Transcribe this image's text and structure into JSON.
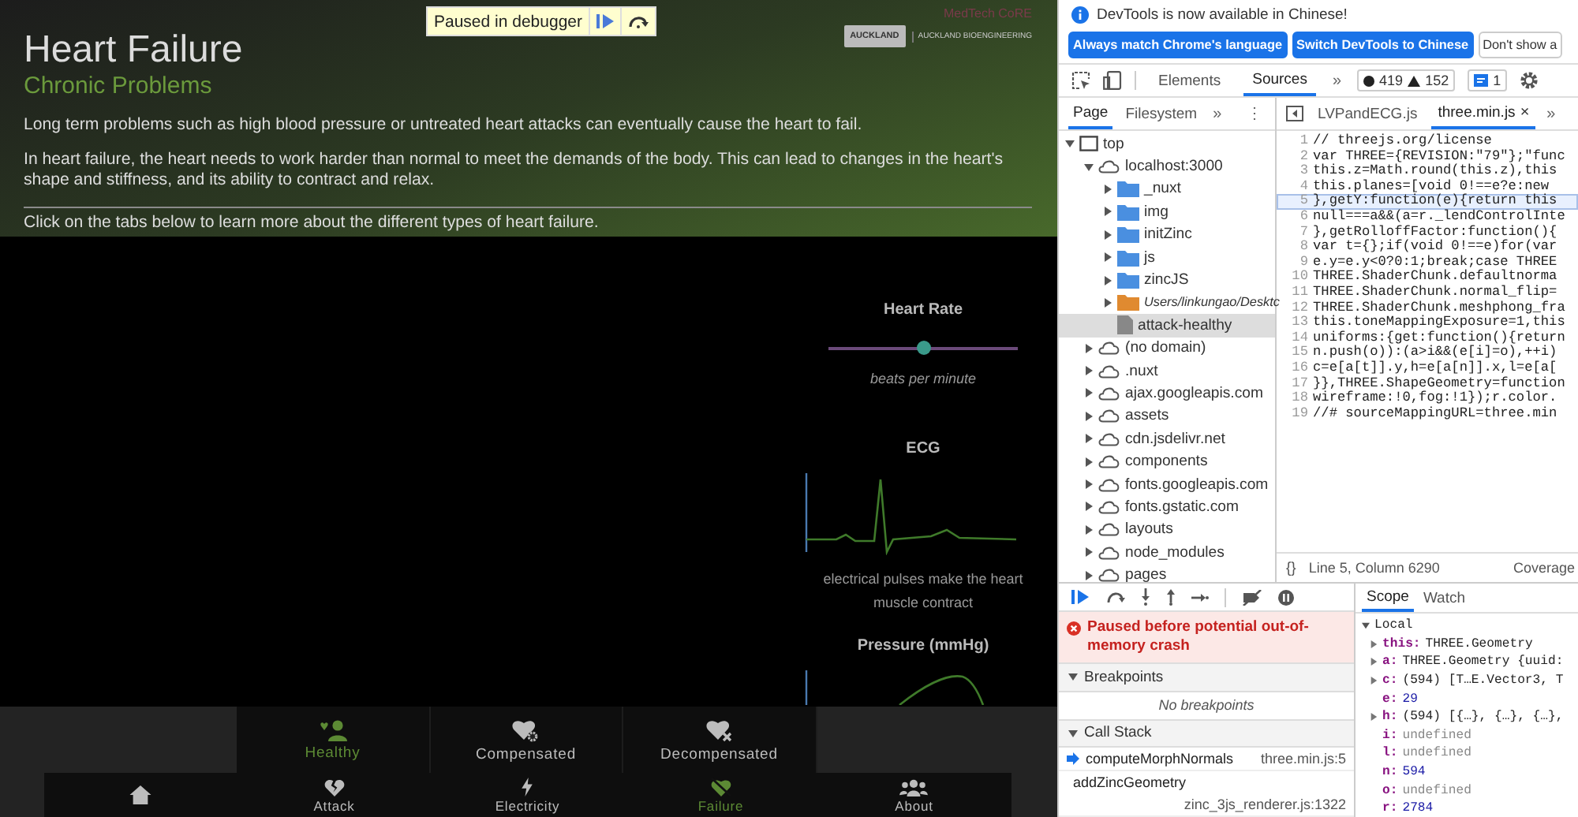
{
  "page": {
    "title": "Heart Failure",
    "subtitle": "Chronic Problems",
    "paragraphs": [
      "Long term problems such as high blood pressure or untreated heart attacks can eventually cause the heart to fail.",
      "In heart failure, the heart needs to work harder than normal to meet the demands of the body. This can lead to changes in the heart's shape and stiffness, and its ability to contract and relax."
    ],
    "instruction": "Click on the tabs below to learn more about the different types of heart failure."
  },
  "logos": {
    "core": "MedTech CoRE",
    "university": "AUCKLAND",
    "institute": "AUCKLAND BIOENGINEERING"
  },
  "debugger_overlay": {
    "label": "Paused in debugger"
  },
  "sidebar": {
    "heart_rate": {
      "title": "Heart Rate",
      "level": 0.5,
      "unit": "beats per minute"
    },
    "ecg": {
      "title": "ECG",
      "caption": "electrical pulses make the heart muscle contract"
    },
    "pressure": {
      "title": "Pressure (mmHg)"
    }
  },
  "tabs_top": [
    {
      "label": "Healthy",
      "kind": "healthy",
      "selected": true
    },
    {
      "label": "Compensated",
      "kind": "compensated",
      "selected": false
    },
    {
      "label": "Decompensated",
      "kind": "decompensated",
      "selected": false
    }
  ],
  "tabs_bottom": [
    {
      "kind": "home",
      "selected": false
    },
    {
      "label": "Attack",
      "kind": "attack",
      "selected": false
    },
    {
      "label": "Electricity",
      "kind": "electricity",
      "selected": false
    },
    {
      "label": "Failure",
      "kind": "failure",
      "selected": true
    },
    {
      "label": "About",
      "kind": "about",
      "selected": false
    }
  ],
  "devtools": {
    "infobar": "DevTools is now available in Chinese!",
    "infobar_buttons": [
      {
        "label": "Always match Chrome's language",
        "primary": true
      },
      {
        "label": "Switch DevTools to Chinese",
        "primary": true
      },
      {
        "label": "Don't show a",
        "primary": false
      }
    ],
    "panels": [
      {
        "label": "Elements",
        "selected": false
      },
      {
        "label": "Sources",
        "selected": true
      }
    ],
    "more": "»",
    "errors": "419",
    "warnings": "152",
    "messages": "1",
    "navigator_tabs": [
      {
        "label": "Page",
        "selected": true
      },
      {
        "label": "Filesystem",
        "selected": false
      }
    ],
    "navigator_more": "»",
    "navigator_menu": "⋮",
    "tree": [
      {
        "label": "top",
        "kind": "frame",
        "expanded": true,
        "selected": false,
        "children": [
          {
            "label": "localhost:3000",
            "kind": "domain",
            "expanded": true,
            "selected": false,
            "children": [
              {
                "label": "_nuxt",
                "kind": "folder",
                "expanded": false,
                "selected": false
              },
              {
                "label": "img",
                "kind": "folder",
                "expanded": false,
                "selected": false
              },
              {
                "label": "initZinc",
                "kind": "folder",
                "expanded": false,
                "selected": false
              },
              {
                "label": "js",
                "kind": "folder",
                "expanded": false,
                "selected": false
              },
              {
                "label": "zincJS",
                "kind": "folder",
                "expanded": false,
                "selected": false
              },
              {
                "label": "Users/linkungao/Desktc",
                "kind": "local_folder",
                "expanded": false,
                "selected": false
              },
              {
                "label": "attack-healthy",
                "kind": "file",
                "selected": true
              }
            ]
          },
          {
            "label": "(no domain)",
            "kind": "domain",
            "expanded": false,
            "selected": false
          },
          {
            "label": ".nuxt",
            "kind": "domain",
            "expanded": false,
            "selected": false
          },
          {
            "label": "ajax.googleapis.com",
            "kind": "domain",
            "expanded": false,
            "selected": false
          },
          {
            "label": "assets",
            "kind": "domain",
            "expanded": false,
            "selected": false
          },
          {
            "label": "cdn.jsdelivr.net",
            "kind": "domain",
            "expanded": false,
            "selected": false
          },
          {
            "label": "components",
            "kind": "domain",
            "expanded": false,
            "selected": false
          },
          {
            "label": "fonts.googleapis.com",
            "kind": "domain",
            "expanded": false,
            "selected": false
          },
          {
            "label": "fonts.gstatic.com",
            "kind": "domain",
            "expanded": false,
            "selected": false
          },
          {
            "label": "layouts",
            "kind": "domain",
            "expanded": false,
            "selected": false
          },
          {
            "label": "node_modules",
            "kind": "domain",
            "expanded": false,
            "selected": false
          },
          {
            "label": "pages",
            "kind": "domain",
            "expanded": false,
            "selected": false
          }
        ]
      }
    ],
    "editor_tabs": [
      {
        "label": "LVPandECG.js",
        "selected": false
      },
      {
        "label": "three.min.js",
        "selected": true,
        "close": "×"
      }
    ],
    "editor_more": "»",
    "code": [
      {
        "number": "1",
        "text": "// threejs.org/license",
        "highlighted": false
      },
      {
        "number": "2",
        "text": "var THREE={REVISION:\"79\"};\"func",
        "highlighted": false
      },
      {
        "number": "3",
        "text": "this.z=Math.round(this.z),this",
        "highlighted": false
      },
      {
        "number": "4",
        "text": "this.planes=[void 0!==e?e:new",
        "highlighted": false
      },
      {
        "number": "5",
        "text": "},getY:function(e){return this",
        "highlighted": true
      },
      {
        "number": "6",
        "text": "null===a&&(a=r._lendControlInte",
        "highlighted": false
      },
      {
        "number": "7",
        "text": "},getRolloffFactor:function(){",
        "highlighted": false
      },
      {
        "number": "8",
        "text": "var t={};if(void 0!==e)for(var",
        "highlighted": false
      },
      {
        "number": "9",
        "text": "e.y=e.y<0?0:1;break;case THREE",
        "highlighted": false
      },
      {
        "number": "10",
        "text": "THREE.ShaderChunk.defaultnorma",
        "highlighted": false
      },
      {
        "number": "11",
        "text": "THREE.ShaderChunk.normal_flip=",
        "highlighted": false
      },
      {
        "number": "12",
        "text": "THREE.ShaderChunk.meshphong_fra",
        "highlighted": false
      },
      {
        "number": "13",
        "text": "this.toneMappingExposure=1,this",
        "highlighted": false
      },
      {
        "number": "14",
        "text": "uniforms:{get:function(){return",
        "highlighted": false
      },
      {
        "number": "15",
        "text": "n.push(o)):(a>i&&(e[i]=o),++i)",
        "highlighted": false
      },
      {
        "number": "16",
        "text": "c=e[a[t]].y,h=e[a[n]].x,l=e[a[",
        "highlighted": false
      },
      {
        "number": "17",
        "text": "}},THREE.ShapeGeometry=function",
        "highlighted": false
      },
      {
        "number": "18",
        "text": "wireframe:!0,fog:!1});r.color.",
        "highlighted": false
      },
      {
        "number": "19",
        "text": "//# sourceMappingURL=three.min",
        "highlighted": false
      }
    ],
    "status": {
      "format": "{}",
      "position": "Line 5, Column 6290",
      "coverage": "Coverage"
    },
    "paused_message": "Paused before potential out-of-memory crash",
    "breakpoints": {
      "title": "Breakpoints",
      "expanded": true,
      "empty": "No breakpoints"
    },
    "call_stack": {
      "title": "Call Stack",
      "expanded": true,
      "frames": [
        {
          "name": "computeMorphNormals",
          "location": "three.min.js:5",
          "current": true
        },
        {
          "name": "addZincGeometry",
          "location": "zinc_3js_renderer.js:1322",
          "current": false
        }
      ]
    },
    "scope_tabs": [
      {
        "label": "Scope",
        "selected": true
      },
      {
        "label": "Watch",
        "selected": false
      }
    ],
    "scope": {
      "title": "Local",
      "expanded": true,
      "vars": [
        {
          "name": "this:",
          "value": "THREE.Geometry",
          "kind": "object",
          "expandable": true
        },
        {
          "name": "a:",
          "value": "THREE.Geometry {uuid:",
          "kind": "object",
          "expandable": true
        },
        {
          "name": "c:",
          "value": "(594) [T…E.Vector3, T",
          "kind": "object",
          "expandable": true
        },
        {
          "name": "e:",
          "value": "29",
          "kind": "number",
          "expandable": false
        },
        {
          "name": "h:",
          "value": "(594) [{…}, {…}, {…},",
          "kind": "object",
          "expandable": true
        },
        {
          "name": "i:",
          "value": "undefined",
          "kind": "undefined",
          "expandable": false
        },
        {
          "name": "l:",
          "value": "undefined",
          "kind": "undefined",
          "expandable": false
        },
        {
          "name": "n:",
          "value": "594",
          "kind": "number",
          "expandable": false
        },
        {
          "name": "o:",
          "value": "undefined",
          "kind": "undefined",
          "expandable": false
        },
        {
          "name": "r:",
          "value": "2784",
          "kind": "number",
          "expandable": false
        }
      ]
    }
  }
}
